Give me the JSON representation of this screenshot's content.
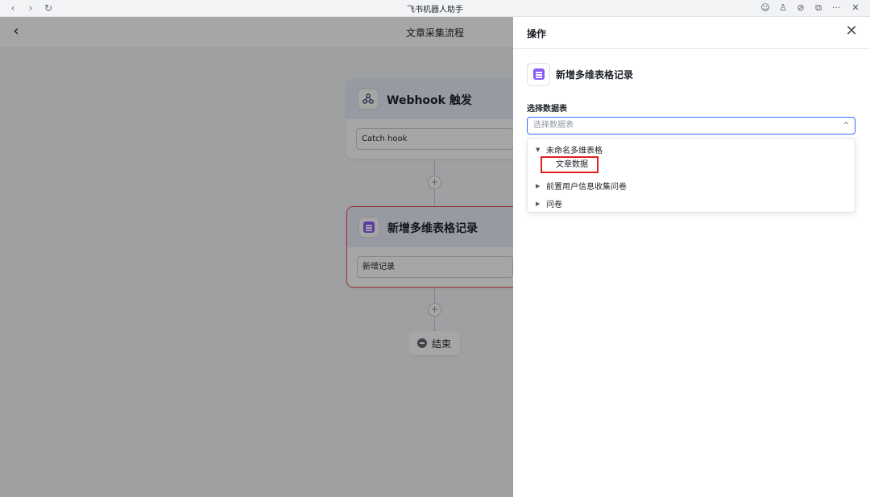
{
  "browser": {
    "title": "飞书机器人助手",
    "back_glyph": "‹",
    "forward_glyph": "›",
    "reload_glyph": "↻",
    "right_icons": [
      "☺",
      "♙",
      "⊘",
      "⧉",
      "···",
      "✕"
    ]
  },
  "flow": {
    "title": "文章采集流程",
    "back_glyph": "‹",
    "trigger": {
      "label": "Webhook 触发",
      "field": "Catch hook"
    },
    "action": {
      "label": "新增多维表格记录",
      "field": "新增记录"
    },
    "plus_glyph": "+",
    "end_label": "结束"
  },
  "panel": {
    "title": "操作",
    "close_glyph": "✕",
    "action_name": "新增多维表格记录",
    "select_label": "选择数据表",
    "select_placeholder": "选择数据表",
    "select_chevron": "^",
    "tree": [
      {
        "label": "未命名多维表格",
        "expanded": true,
        "toggle": "▼",
        "children": [
          "文章数据"
        ]
      },
      {
        "label": "前置用户信息收集问卷",
        "expanded": false,
        "toggle": "▶"
      },
      {
        "label": "问卷",
        "expanded": false,
        "toggle": "▶"
      }
    ]
  },
  "colors": {
    "accent": "#3370ff",
    "table_icon": "#8b5cf6",
    "highlight_box": "#e02020",
    "node_header": "#e8ebfb"
  }
}
